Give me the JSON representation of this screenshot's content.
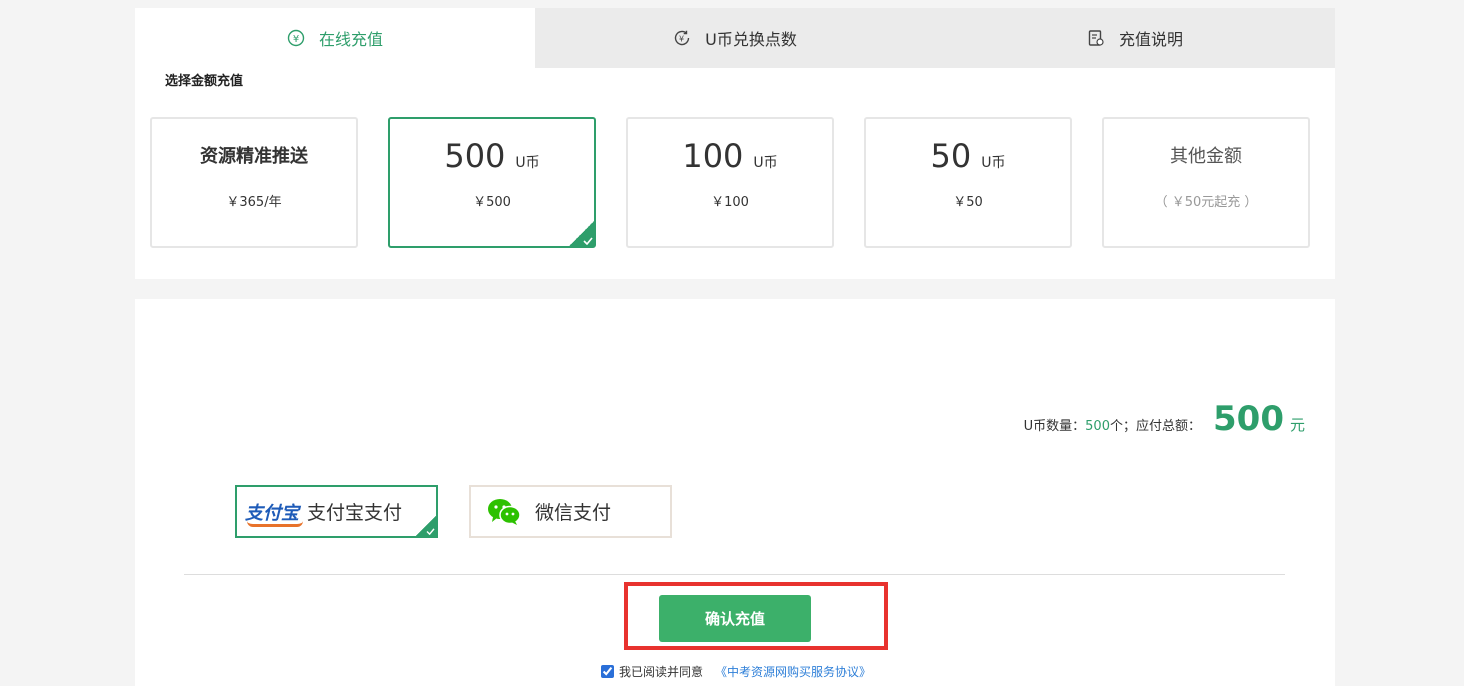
{
  "tabs": [
    {
      "label": "在线充值",
      "icon": "yen-circle-icon",
      "active": true
    },
    {
      "label": "U币兑换点数",
      "icon": "exchange-coin-icon",
      "active": false
    },
    {
      "label": "充值说明",
      "icon": "document-icon",
      "active": false
    }
  ],
  "section_label": "选择金额充值",
  "cards": [
    {
      "title": "资源精准推送",
      "price": "￥365/年"
    },
    {
      "amount": "500",
      "unit": "U币",
      "price": "￥500",
      "selected": true
    },
    {
      "amount": "100",
      "unit": "U币",
      "price": "￥100"
    },
    {
      "amount": "50",
      "unit": "U币",
      "price": "￥50"
    },
    {
      "title": "其他金额",
      "price": "（ ￥50元起充 ）"
    }
  ],
  "summary": {
    "count_label": "U币数量：",
    "count_value": "500",
    "count_suffix": "个；应付总额：",
    "total": "500",
    "currency": "元"
  },
  "payment": {
    "alipay_logo": "支付宝",
    "alipay_label": "支付宝支付",
    "wechat_label": "微信支付"
  },
  "confirm_label": "确认充值",
  "agreement": {
    "text": "我已阅读并同意",
    "link": "《中考资源网购买服务协议》",
    "checked": true
  },
  "colors": {
    "accent": "#2e9e6b",
    "button": "#3cb06a",
    "highlight_box": "#e8322e",
    "link": "#2e7fd8"
  }
}
